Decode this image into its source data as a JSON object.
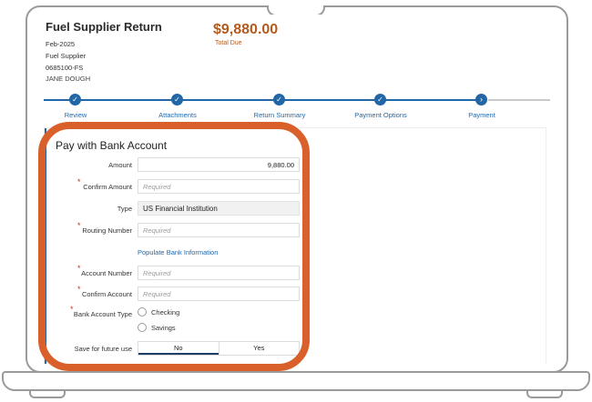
{
  "header": {
    "title": "Fuel Supplier Return",
    "total_amount": "$9,880.00",
    "total_label": "Total Due",
    "period": "Feb-2025",
    "return_type": "Fuel Supplier",
    "account_id": "0685100-FS",
    "taxpayer_name": "JANE DOUGH"
  },
  "stepper": {
    "steps": [
      {
        "label": "Review",
        "status": "complete",
        "icon": "check-icon"
      },
      {
        "label": "Attachments",
        "status": "complete",
        "icon": "check-icon"
      },
      {
        "label": "Return Summary",
        "status": "complete",
        "icon": "check-icon"
      },
      {
        "label": "Payment Options",
        "status": "complete",
        "icon": "check-icon"
      },
      {
        "label": "Payment",
        "status": "current",
        "icon": "chevron-right-icon"
      }
    ]
  },
  "form": {
    "title": "Pay with Bank Account",
    "amount_label": "Amount",
    "amount_value": "9,880.00",
    "confirm_amount_label": "Confirm Amount",
    "confirm_amount_placeholder": "Required",
    "type_label": "Type",
    "type_value": "US Financial Institution",
    "routing_label": "Routing Number",
    "routing_placeholder": "Required",
    "populate_link": "Populate Bank Information",
    "account_number_label": "Account Number",
    "account_number_placeholder": "Required",
    "confirm_account_label": "Confirm Account",
    "confirm_account_placeholder": "Required",
    "account_type_label": "Bank Account Type",
    "account_type_options": [
      "Checking",
      "Savings"
    ],
    "save_label": "Save for future use",
    "save_options": [
      "No",
      "Yes"
    ],
    "save_selected": "No"
  },
  "colors": {
    "accent": "#2366a8",
    "amount": "#b35a1f",
    "highlight": "#d9602a",
    "required": "#c0392b"
  }
}
